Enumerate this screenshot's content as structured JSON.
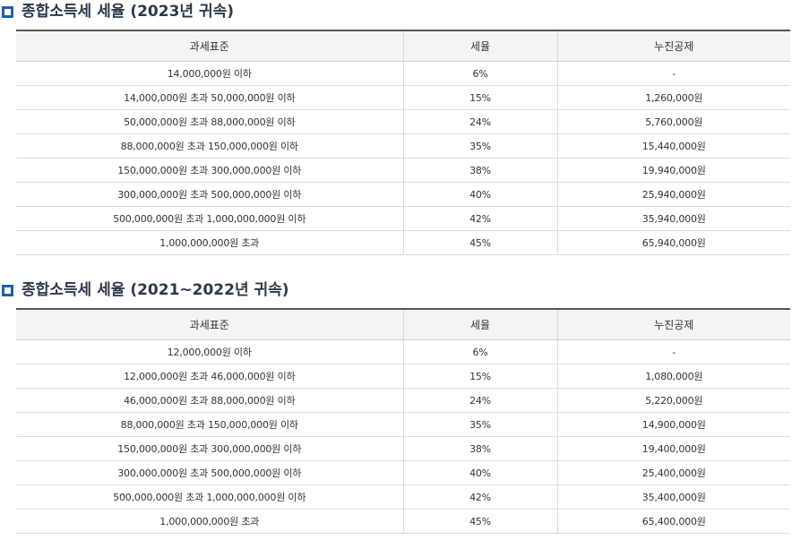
{
  "sections": [
    {
      "title": "종합소득세 세율 (2023년 귀속)",
      "headers": [
        "과세표준",
        "세율",
        "누진공제"
      ],
      "rows": [
        [
          "14,000,000원 이하",
          "6%",
          "-"
        ],
        [
          "14,000,000원 초과 50,000,000원 이하",
          "15%",
          "1,260,000원"
        ],
        [
          "50,000,000원 초과 88,000,000원 이하",
          "24%",
          "5,760,000원"
        ],
        [
          "88,000,000원 초과 150,000,000원 이하",
          "35%",
          "15,440,000원"
        ],
        [
          "150,000,000원 초과 300,000,000원 이하",
          "38%",
          "19,940,000원"
        ],
        [
          "300,000,000원 초과 500,000,000원 이하",
          "40%",
          "25,940,000원"
        ],
        [
          "500,000,000원 초과 1,000,000,000원 이하",
          "42%",
          "35,940,000원"
        ],
        [
          "1,000,000,000원 초과",
          "45%",
          "65,940,000원"
        ]
      ]
    },
    {
      "title": "종합소득세 세율 (2021~2022년 귀속)",
      "headers": [
        "과세표준",
        "세율",
        "누진공제"
      ],
      "rows": [
        [
          "12,000,000원 이하",
          "6%",
          "-"
        ],
        [
          "12,000,000원 초과 46,000,000원 이하",
          "15%",
          "1,080,000원"
        ],
        [
          "46,000,000원 초과 88,000,000원 이하",
          "24%",
          "5,220,000원"
        ],
        [
          "88,000,000원 초과 150,000,000원 이하",
          "35%",
          "14,900,000원"
        ],
        [
          "150,000,000원 초과 300,000,000원 이하",
          "38%",
          "19,400,000원"
        ],
        [
          "300,000,000원 초과 500,000,000원 이하",
          "40%",
          "25,400,000원"
        ],
        [
          "500,000,000원 초과 1,000,000,000원 이하",
          "42%",
          "35,400,000원"
        ],
        [
          "1,000,000,000원 초과",
          "45%",
          "65,400,000원"
        ]
      ]
    }
  ],
  "colors": {
    "bullet": "#1f5fa8",
    "header_bg": "#f4f4f4",
    "title": "#2a3a4c"
  }
}
